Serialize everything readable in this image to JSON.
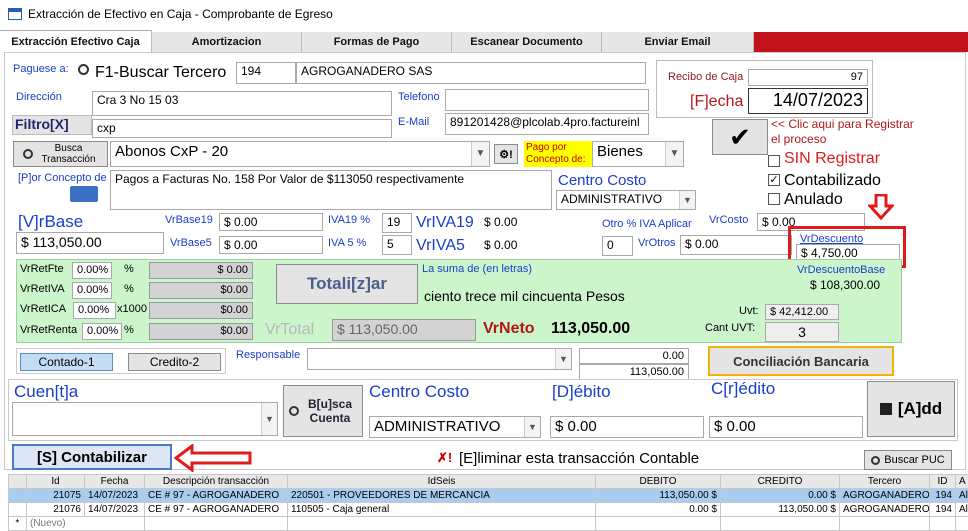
{
  "window": {
    "title": "Extracción de Efectivo en Caja - Comprobante de Egreso"
  },
  "tabs": [
    "Extracción Efectivo Caja",
    "Amortizacion",
    "Formas de Pago",
    "Escanear Documento",
    "Enviar Email"
  ],
  "form": {
    "paguese_label": "Paguese a:",
    "buscar_tercero": "F1-Buscar Tercero",
    "tercero_id": "194",
    "tercero_name": "AGROGANADERO SAS",
    "direccion_label": "Dirección",
    "direccion": "Cra 3 No 15 03",
    "telefono_label": "Telefono",
    "telefono": "",
    "filtro_label": "Filtro[X]",
    "filtro": "cxp",
    "email_label": "E-Mail",
    "email": "891201428@plcolab.4pro.factureinl",
    "recibo_label": "Recibo de Caja",
    "recibo": "97",
    "fecha_label": "[F]echa",
    "fecha": "14/07/2023",
    "clic_text": "<< Clic aqui para Registrar el proceso",
    "sin_registrar": "SIN Registrar",
    "contabilizado": "Contabilizado",
    "anulado": "Anulado",
    "busca_transaccion": "Busca Transacción",
    "transaccion": "Abonos CxP - 20",
    "pago_concepto_label": "Pago por Concepto de:",
    "pago_concepto": "Bienes",
    "por_concepto_label": "[P]or Concepto de",
    "concepto": "Pagos a Facturas No. 158 Por Valor de $113050 respectivamente",
    "centro_costo_label": "Centro Costo",
    "centro_costo": "ADMINISTRATIVO",
    "vrbase_label": "[V]rBase",
    "vrbase": "$ 113,050.00",
    "vrbase19_label": "VrBase19",
    "vrbase19": "$ 0.00",
    "vrbase5_label": "VrBase5",
    "vrbase5": "$ 0.00",
    "iva19_label": "IVA19 %",
    "iva19": "19",
    "iva5_label": "IVA 5 %",
    "iva5": "5",
    "vriva19_label": "VrIVA19",
    "vriva19": "$ 0.00",
    "vriva5_label": "VrIVA5",
    "vriva5": "$ 0.00",
    "otro_iva_label": "Otro % IVA Aplicar",
    "otro_iva": "0",
    "vrcosto_label": "VrCosto",
    "vrcosto": "$ 0.00",
    "vrotros_label": "VrOtros",
    "vrotros": "$ 0.00",
    "vrdescuento_label": "VrDescuento",
    "vrdescuento": "$ 4,750.00",
    "vrdescuentobase_label": "VrDescuentoBase",
    "vrdescuentobase": "$ 108,300.00"
  },
  "retenciones": {
    "rows": [
      {
        "label": "VrRetFte",
        "pct": "0.00%",
        "unit": "%",
        "value": "$ 0.00"
      },
      {
        "label": "VrRetIVA",
        "pct": "0.00%",
        "unit": "%",
        "value": "$0.00"
      },
      {
        "label": "VrRetICA",
        "pct": "0.00%",
        "unit": "x1000",
        "value": "$0.00"
      },
      {
        "label": "VrRetRenta",
        "pct": "0.00%",
        "unit": "%",
        "value": "$0.00"
      }
    ],
    "totalizar": "Totali[z]ar",
    "suma_label": "La suma de (en letras)",
    "suma": "ciento trece mil cincuenta Pesos",
    "uvt_label": "Uvt:",
    "uvt": "$ 42,412.00",
    "cant_uvt_label": "Cant UVT:",
    "cant_uvt": "3",
    "vrtotal_label": "VrTotal",
    "vrtotal": "$ 113,050.00",
    "vrneto_label": "VrNeto",
    "vrneto": "113,050.00"
  },
  "pago": {
    "contado": "Contado-1",
    "credito": "Credito-2",
    "responsable_label": "Responsable",
    "responsable": "",
    "val1": "0.00",
    "val2": "113,050.00",
    "conciliacion": "Conciliación Bancaria"
  },
  "asiento": {
    "cuenta_label": "Cuen[t]a",
    "busca_cuenta": "B[u]sca Cuenta",
    "centro_costo_label": "Centro Costo",
    "centro_costo": "ADMINISTRATIVO",
    "debito_label": "[D]ébito",
    "debito": "$ 0.00",
    "credito_label": "C[r]édito",
    "credito": "$ 0.00",
    "add": "[A]dd"
  },
  "actions": {
    "contabilizar": "[S] Contabilizar",
    "eliminar": "[E]liminar esta transacción Contable",
    "buscar_puc": "Buscar PUC"
  },
  "grid": {
    "headers": [
      "Id",
      "Fecha",
      "Descripción transacción",
      "IdSeis",
      "DEBITO",
      "CREDITO",
      "Tercero",
      "ID",
      "A"
    ],
    "rows": [
      [
        "21075",
        "14/07/2023",
        "CE # 97 - AGROGANADERO",
        "220501 - PROVEEDORES DE MERCANCIA",
        "113,050.00 $",
        "0.00 $",
        "AGROGANADERO",
        "194",
        "Al"
      ],
      [
        "21076",
        "14/07/2023",
        "CE # 97 - AGROGANADERO",
        "110505 - Caja general",
        "0.00 $",
        "113,050.00 $",
        "AGROGANADERO",
        "194",
        "Al"
      ]
    ],
    "new_row": "(Nuevo)"
  },
  "colors": {
    "accent_red": "#e01b1b",
    "label_blue": "#1a3ec8",
    "panel_green": "#ccf5cc",
    "tab_strip_red": "#c1121c"
  }
}
